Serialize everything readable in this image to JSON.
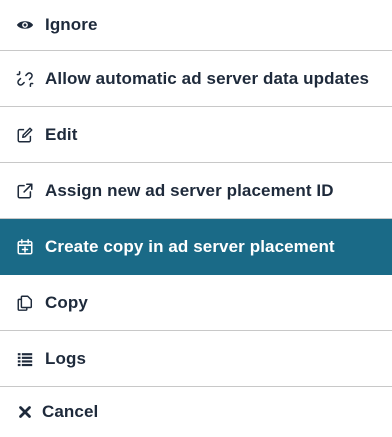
{
  "menu": {
    "items": [
      {
        "label": "Ignore",
        "icon": "eye-icon"
      },
      {
        "label": "Allow automatic ad server data updates",
        "icon": "unlink-icon"
      },
      {
        "label": "Edit",
        "icon": "edit-icon"
      },
      {
        "label": "Assign new ad server placement ID",
        "icon": "external-link-icon"
      },
      {
        "label": "Create copy in ad server placement",
        "icon": "calendar-plus-icon",
        "active": true
      },
      {
        "label": "Copy",
        "icon": "copy-icon"
      },
      {
        "label": "Logs",
        "icon": "list-icon"
      },
      {
        "label": "Cancel",
        "icon": "close-icon"
      }
    ]
  },
  "colors": {
    "active_background": "#1a6a87",
    "text": "#1e2a3b",
    "divider": "#c8c8c8"
  }
}
